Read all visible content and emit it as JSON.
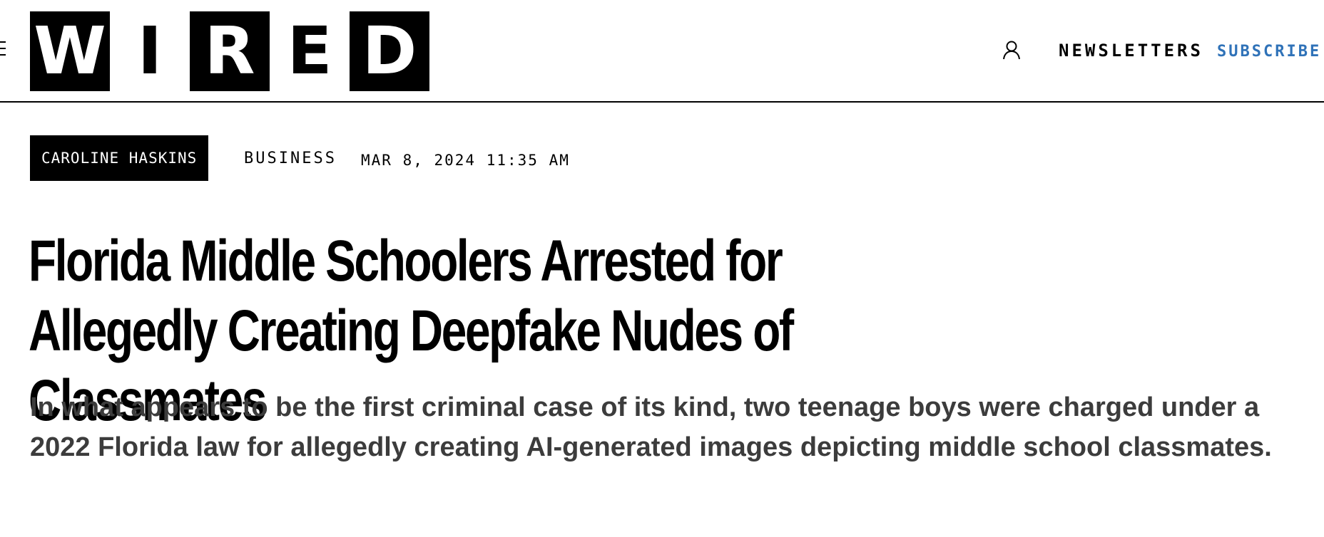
{
  "header": {
    "logo_letters": [
      "W",
      "I",
      "R",
      "E",
      "D"
    ],
    "newsletters_label": "NEWSLETTERS",
    "subscribe_label": "SUBSCRIBE",
    "icons": {
      "menu": "menu-icon",
      "account": "user-icon"
    },
    "colors": {
      "subscribe": "#2f72b8"
    }
  },
  "article": {
    "author": "CAROLINE HASKINS",
    "section": "BUSINESS",
    "date": "MAR 8, 2024 11:35 AM",
    "headline": "Florida Middle Schoolers Arrested for Allegedly Creating Deepfake Nudes of Classmates",
    "dek": "In what appears to be the first criminal case of its kind, two teenage boys were charged under a 2022 Florida law for allegedly creating AI-generated images depicting middle school classmates."
  }
}
